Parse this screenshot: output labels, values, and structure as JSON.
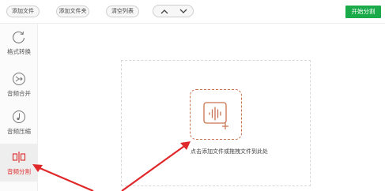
{
  "toolbar": {
    "add_file": "添加文件",
    "add_folder": "添加文件夹",
    "clear_list": "清空列表",
    "start": "开始分割"
  },
  "sidebar": {
    "items": [
      {
        "label": "格式转换",
        "icon": "refresh-icon"
      },
      {
        "label": "音频合并",
        "icon": "merge-icon"
      },
      {
        "label": "音频压缩",
        "icon": "music-note-icon"
      },
      {
        "label": "音频分割",
        "icon": "split-icon"
      }
    ],
    "active_index": 3
  },
  "dropzone": {
    "text": "点击添加文件或拖拽文件到此处",
    "icon": "audio-add-icon"
  },
  "colors": {
    "accent_red": "#e0282a",
    "start_green": "#1aaa4a",
    "icon_orange": "#c8734f"
  }
}
